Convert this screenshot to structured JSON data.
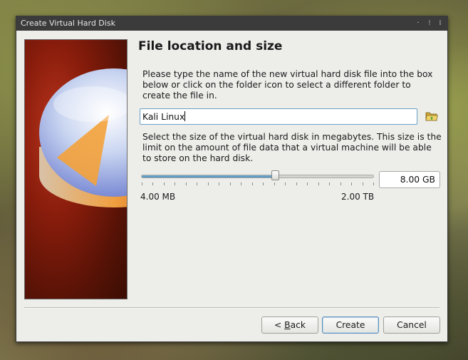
{
  "window": {
    "title": "Create Virtual Hard Disk",
    "wm_buttons": [
      "·",
      "⁝",
      "⁞"
    ]
  },
  "page": {
    "heading": "File location and size",
    "description_location": "Please type the name of the new virtual hard disk file into the box below or click on the folder icon to select a different folder to create the file in.",
    "description_size": "Select the size of the virtual hard disk in megabytes. This size is the limit on the amount of file data that a virtual machine will be able to store on the hard disk."
  },
  "file_location": {
    "value": "Kali Linux",
    "folder_icon": "folder-open-icon"
  },
  "size": {
    "slider_fraction": 0.575,
    "min_label": "4.00 MB",
    "max_label": "2.00 TB",
    "value": "8.00 GB"
  },
  "buttons": {
    "back_prefix": "< ",
    "back_mnemonic": "B",
    "back_rest": "ack",
    "create": "Create",
    "cancel": "Cancel"
  },
  "colors": {
    "accent": "#4a8bb8",
    "dialog_bg": "#ededea",
    "titlebar_bg": "#3b3b3b"
  }
}
